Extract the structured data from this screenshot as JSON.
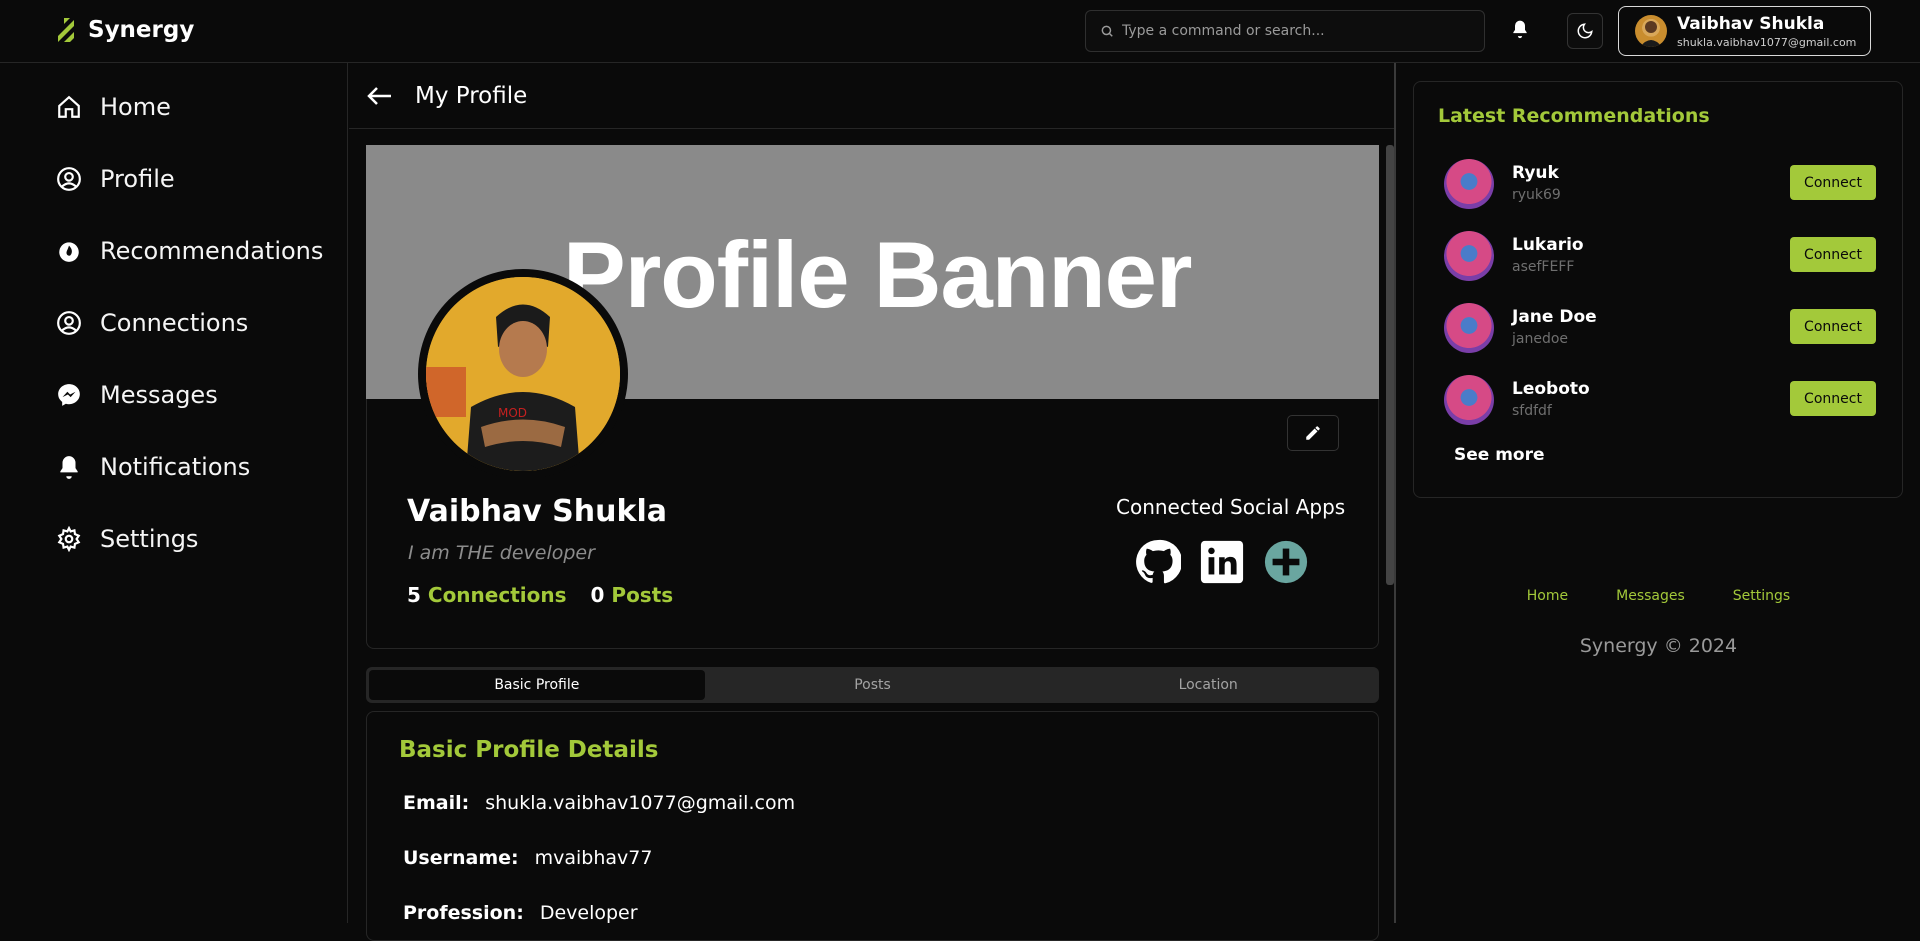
{
  "app": {
    "name": "Synergy"
  },
  "search": {
    "placeholder": "Type a command or search..."
  },
  "user": {
    "name": "Vaibhav Shukla",
    "email": "shukla.vaibhav1077@gmail.com"
  },
  "sidebar": {
    "items": [
      {
        "label": "Home",
        "icon": "home-icon"
      },
      {
        "label": "Profile",
        "icon": "user-circle-icon"
      },
      {
        "label": "Recommendations",
        "icon": "flame-icon"
      },
      {
        "label": "Connections",
        "icon": "user-circle-icon"
      },
      {
        "label": "Messages",
        "icon": "messenger-icon"
      },
      {
        "label": "Notifications",
        "icon": "bell-icon"
      },
      {
        "label": "Settings",
        "icon": "gear-icon"
      }
    ]
  },
  "main": {
    "title": "My Profile",
    "banner_text": "Profile Banner",
    "profile": {
      "name": "Vaibhav Shukla",
      "bio": "I am THE developer",
      "connections_count": "5",
      "connections_label": "Connections",
      "posts_count": "0",
      "posts_label": "Posts",
      "social_title": "Connected Social Apps",
      "social_apps": [
        "github-icon",
        "linkedin-icon",
        "add-icon"
      ]
    },
    "tabs": [
      {
        "label": "Basic Profile",
        "active": true
      },
      {
        "label": "Posts",
        "active": false
      },
      {
        "label": "Location",
        "active": false
      }
    ],
    "details": {
      "title": "Basic Profile Details",
      "rows": [
        {
          "key": "Email:",
          "value": "shukla.vaibhav1077@gmail.com"
        },
        {
          "key": "Username:",
          "value": "mvaibhav77"
        },
        {
          "key": "Profession:",
          "value": "Developer"
        }
      ]
    }
  },
  "recommendations": {
    "title": "Latest Recommendations",
    "connect_label": "Connect",
    "items": [
      {
        "name": "Ryuk",
        "username": "ryuk69"
      },
      {
        "name": "Lukario",
        "username": "asefFEFF"
      },
      {
        "name": "Jane Doe",
        "username": "janedoe"
      },
      {
        "name": "Leoboto",
        "username": "sfdfdf"
      }
    ],
    "see_more": "See more"
  },
  "footer": {
    "links": [
      "Home",
      "Messages",
      "Settings"
    ],
    "copyright": "Synergy © 2024"
  },
  "colors": {
    "accent": "#a3c93a",
    "background": "#0a0a0a",
    "banner": "#8a8a8a"
  }
}
